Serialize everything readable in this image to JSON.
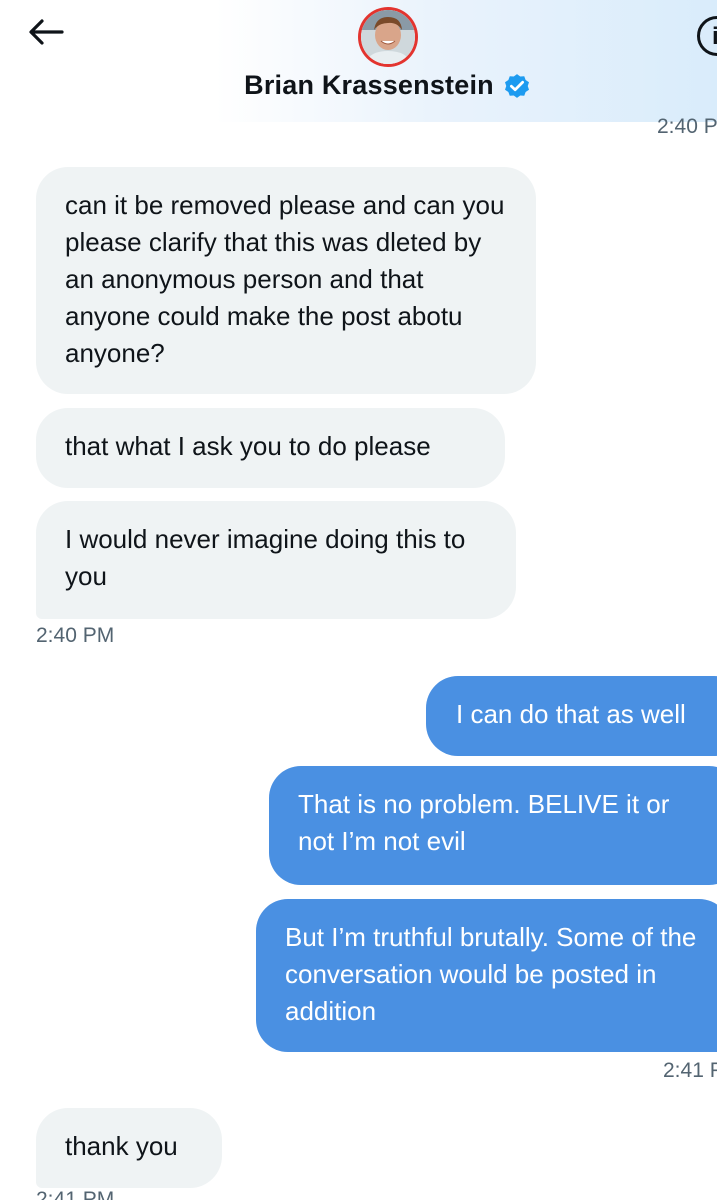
{
  "header": {
    "title": "Brian Krassenstein",
    "info_label": "i"
  },
  "timestamps": {
    "top_partial": "2:40 P",
    "group1": "2:40 PM",
    "group2": "2:41 P",
    "bottom_partial": "2:41 PM"
  },
  "messages": [
    {
      "direction": "incoming",
      "text": "can it be removed please and can you please clarify that this was dleted by an anonymous person and that anyone could make the post abotu anyone?"
    },
    {
      "direction": "incoming",
      "text": "that what I ask you to do please"
    },
    {
      "direction": "incoming",
      "text": "I would never imagine doing this to you"
    },
    {
      "direction": "outgoing",
      "text": "I can do that as well"
    },
    {
      "direction": "outgoing",
      "text": "That is no problem. BELIVE it or not I’m not evil"
    },
    {
      "direction": "outgoing",
      "text": "But I’m truthful brutally. Some of the conversation would be posted in addition"
    },
    {
      "direction": "incoming",
      "text": "thank you"
    }
  ],
  "icons": {
    "back": "back-arrow-icon",
    "verified": "verified-badge-icon",
    "info": "info-icon",
    "avatar": "avatar"
  },
  "colors": {
    "incoming_bubble": "#eff3f4",
    "outgoing_bubble": "#4a90e2",
    "verified": "#1d9bf0",
    "avatar_ring": "#e3342f",
    "timestamp": "#536471"
  }
}
